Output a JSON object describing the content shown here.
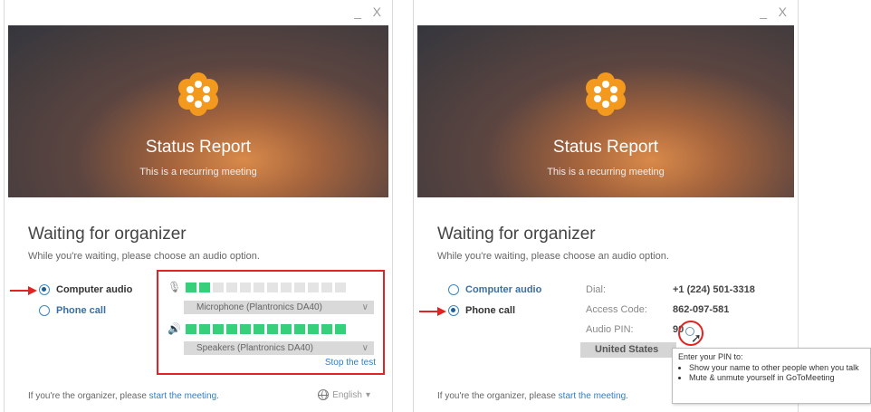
{
  "window_controls": {
    "minimize": "_",
    "close": "X"
  },
  "left_panel": {
    "meeting_title": "Status Report",
    "meeting_subtitle": "This is a recurring meeting",
    "waiting_heading": "Waiting for organizer",
    "waiting_text": "While you're waiting, please choose an audio option.",
    "options": [
      {
        "label": "Computer audio",
        "selected": true
      },
      {
        "label": "Phone call",
        "selected": false
      }
    ],
    "audio_test": {
      "microphone_level": 2,
      "microphone_bars": 12,
      "microphone_device": "Microphone (Plantronics DA40)",
      "speaker_level": 12,
      "speaker_bars": 12,
      "speaker_device": "Speakers (Plantronics DA40)",
      "stop_label": "Stop the test"
    },
    "footer_text": "If you're the organizer, please",
    "footer_link": "start the meeting.",
    "language": "English"
  },
  "right_panel": {
    "meeting_title": "Status Report",
    "meeting_subtitle": "This is a recurring meeting",
    "waiting_heading": "Waiting for organizer",
    "waiting_text": "While you're waiting, please choose an audio option.",
    "options": [
      {
        "label": "Computer audio",
        "selected": false
      },
      {
        "label": "Phone call",
        "selected": true
      }
    ],
    "dial_label": "Dial:",
    "dial_value": "+1 (224) 501-3318",
    "access_code_label": "Access Code:",
    "access_code_value": "862-097-581",
    "audio_pin_label": "Audio PIN:",
    "audio_pin_value": "90",
    "country": "United States",
    "footer_text": "If you're the organizer, please",
    "footer_link": "start the meeting.",
    "tooltip": {
      "heading": "Enter your PIN to:",
      "items": [
        "Show your name to other people when you talk",
        "Mute & unmute yourself in GoToMeeting"
      ]
    }
  },
  "colors": {
    "accent_blue": "#2f7ec4",
    "level_green": "#36d07a",
    "highlight_red": "#e02424"
  }
}
